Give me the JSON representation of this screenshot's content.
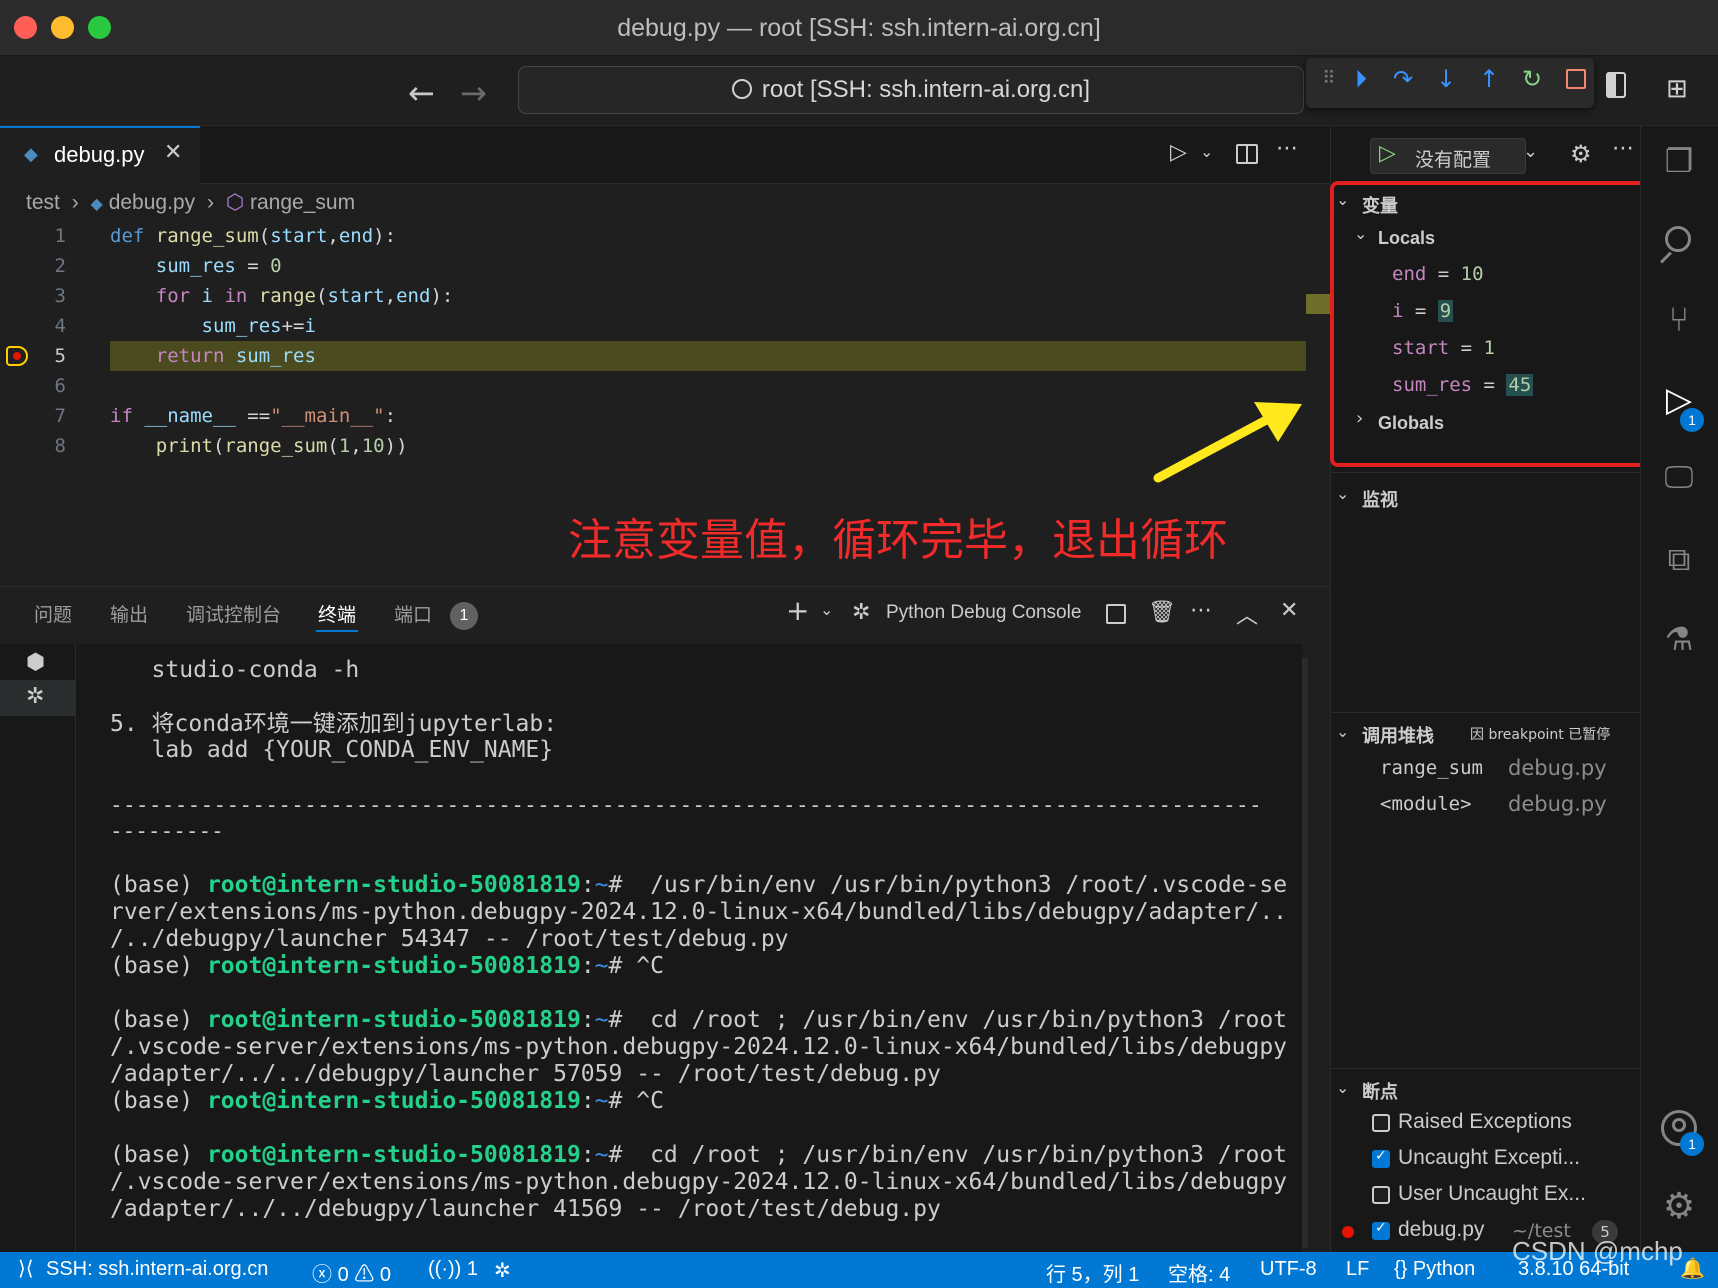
{
  "window": {
    "title": "debug.py — root [SSH: ssh.intern-ai.org.cn]"
  },
  "command_center": {
    "text": "root [SSH: ssh.intern-ai.org.cn]"
  },
  "editor_tab": {
    "label": "debug.py"
  },
  "breadcrumb": {
    "folder": "test",
    "file": "debug.py",
    "symbol": "range_sum"
  },
  "code": {
    "line_numbers": [
      "1",
      "2",
      "3",
      "4",
      "5",
      "6",
      "7",
      "8"
    ],
    "current_line": "5"
  },
  "annotation": "注意变量值，循环完毕，退出循环",
  "panel": {
    "tabs": [
      "问题",
      "输出",
      "调试控制台",
      "终端",
      "端口"
    ],
    "ports_badge": "1",
    "terminal_name": "Python Debug Console"
  },
  "terminal": {
    "lines": [
      "   studio-conda -h",
      "",
      "5. 将conda环境一键添加到jupyterlab:",
      "   lab add {YOUR_CONDA_ENV_NAME}",
      "",
      "-----------------------------------------------------------------------------------------",
      "---------"
    ],
    "prompt_base": "(base) ",
    "prompt_user": "root@intern-studio-50081819",
    "prompt_sep": ":",
    "prompt_path": "~",
    "prompt_end": "# ",
    "cmd1": [
      " /usr/bin/env /usr/bin/python3 /root/.vscode-se",
      "rver/extensions/ms-python.debugpy-2024.12.0-linux-x64/bundled/libs/debugpy/adapter/..",
      "/../debugpy/launcher 54347 -- /root/test/debug.py"
    ],
    "ctrlc": "^C",
    "cmd2": [
      " cd /root ; /usr/bin/env /usr/bin/python3 /root",
      "/.vscode-server/extensions/ms-python.debugpy-2024.12.0-linux-x64/bundled/libs/debugpy",
      "/adapter/../../debugpy/launcher 57059 -- /root/test/debug.py"
    ],
    "cmd3": [
      " cd /root ; /usr/bin/env /usr/bin/python3 /root",
      "/.vscode-server/extensions/ms-python.debugpy-2024.12.0-linux-x64/bundled/libs/debugpy",
      "/adapter/../../debugpy/launcher 41569 -- /root/test/debug.py"
    ]
  },
  "debug_sidebar": {
    "config_label": "没有配置",
    "variables_title": "变量",
    "locals_title": "Locals",
    "locals": [
      {
        "name": "end",
        "value": "10"
      },
      {
        "name": "i",
        "value": "9"
      },
      {
        "name": "start",
        "value": "1"
      },
      {
        "name": "sum_res",
        "value": "45"
      }
    ],
    "globals_title": "Globals",
    "watch_title": "监视",
    "callstack_title": "调用堆栈",
    "callstack_status": "因 breakpoint 已暂停",
    "frames": [
      {
        "name": "range_sum",
        "file": "debug.py"
      },
      {
        "name": "<module>",
        "file": "debug.py"
      }
    ],
    "breakpoints_title": "断点",
    "breakpoints": [
      {
        "label": "Raised Exceptions",
        "checked": false
      },
      {
        "label": "Uncaught Excepti...",
        "checked": true
      },
      {
        "label": "User Uncaught Ex...",
        "checked": false
      }
    ],
    "bp_file": {
      "label": "debug.py",
      "path": "~/test",
      "line": "5"
    }
  },
  "activity_badges": {
    "debug": "1",
    "accounts": "1"
  },
  "status_bar": {
    "remote": "SSH: ssh.intern-ai.org.cn",
    "errors": "0",
    "warnings": "0",
    "ports": "1",
    "position": "行 5，列 1",
    "spaces": "空格: 4",
    "encoding": "UTF-8",
    "eol": "LF",
    "language": "Python",
    "interpreter": "3.8.10 64-bit"
  },
  "watermark": "CSDN @mchp",
  "colors": {
    "accent": "#0078d4",
    "annotation": "#f22a2a",
    "prompt_green": "#23d18b",
    "highlight": "#4b4b1f"
  }
}
